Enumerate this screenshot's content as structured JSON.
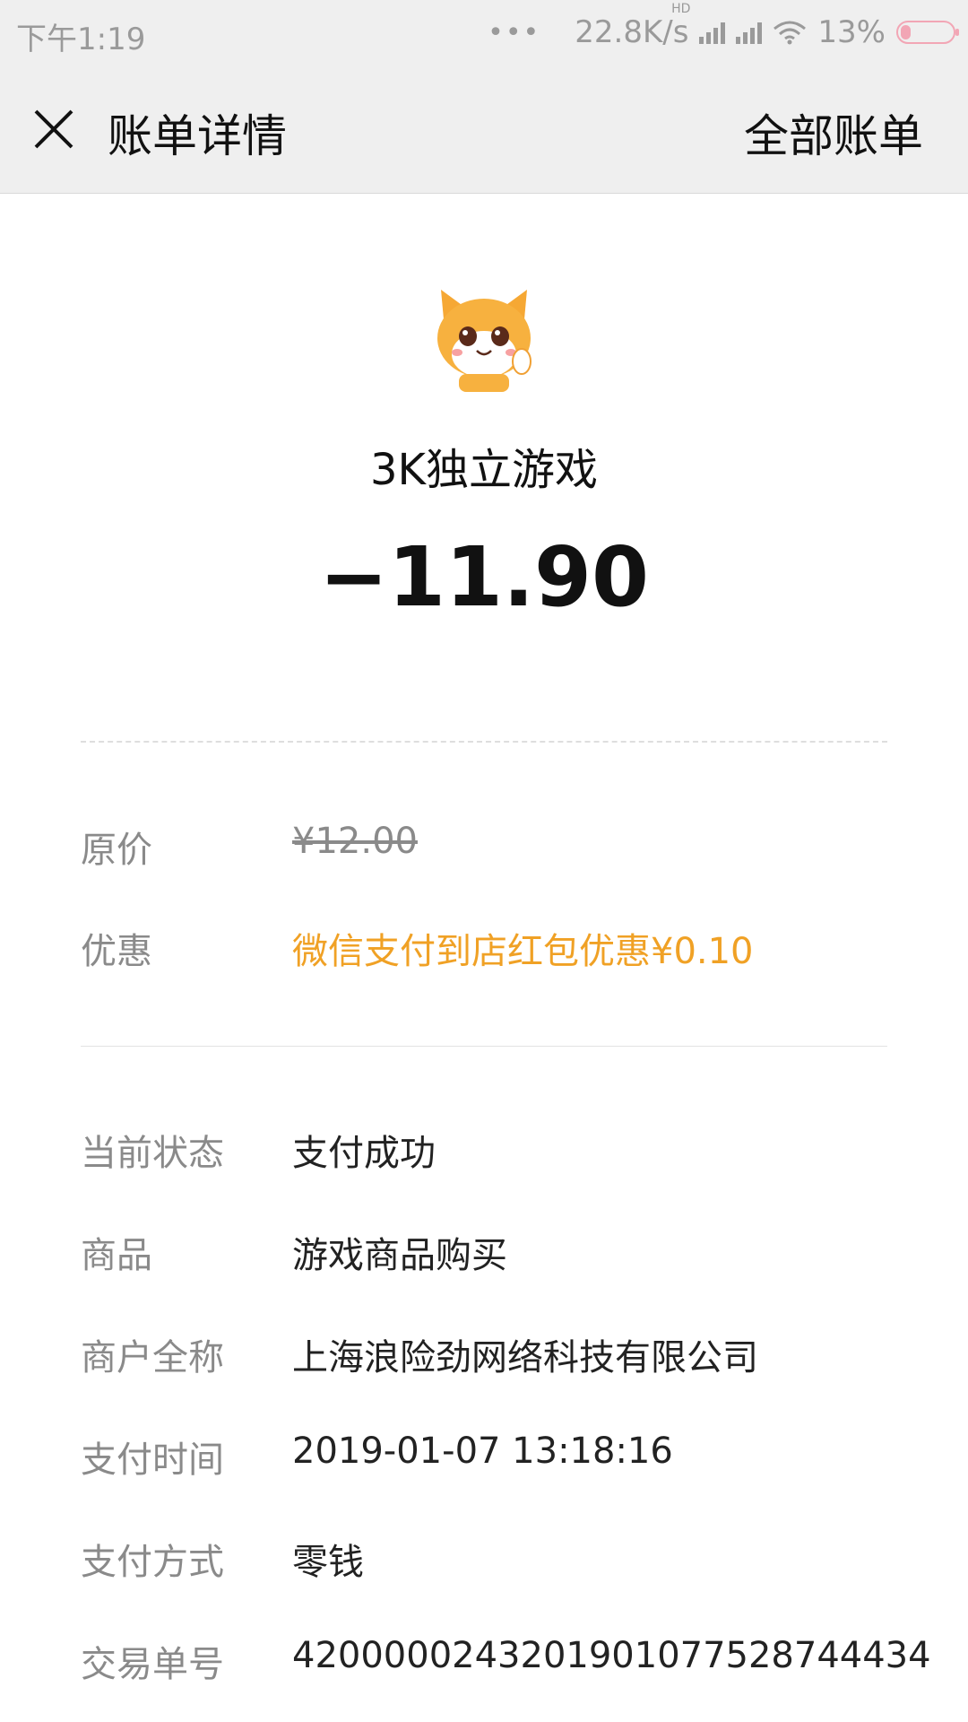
{
  "status_bar": {
    "time": "下午1:19",
    "dots": "•••",
    "network_speed": "22.8K/s",
    "hd_label": "HD",
    "battery_percent": "13%",
    "battery_level": 0.13,
    "battery_color": "#f2a6b5"
  },
  "navbar": {
    "title": "账单详情",
    "right_link": "全部账单",
    "close_icon": "close-icon"
  },
  "merchant": {
    "name": "3K独立游戏",
    "amount": "−11.90",
    "avatar_icon": "cat-avatar-icon"
  },
  "pricing": {
    "original_label": "原价",
    "original_value": "¥12.00",
    "discount_label": "优惠",
    "discount_value": "微信支付到店红包优惠¥0.10",
    "discount_color": "#f0a125"
  },
  "details": [
    {
      "label": "当前状态",
      "value": "支付成功"
    },
    {
      "label": "商品",
      "value": "游戏商品购买"
    },
    {
      "label": "商户全称",
      "value": "上海浪险劲网络科技有限公司"
    },
    {
      "label": "支付时间",
      "value": "2019-01-07 13:18:16"
    },
    {
      "label": "支付方式",
      "value": "零钱"
    },
    {
      "label": "交易单号",
      "value": "4200000243201901077528744434"
    }
  ]
}
